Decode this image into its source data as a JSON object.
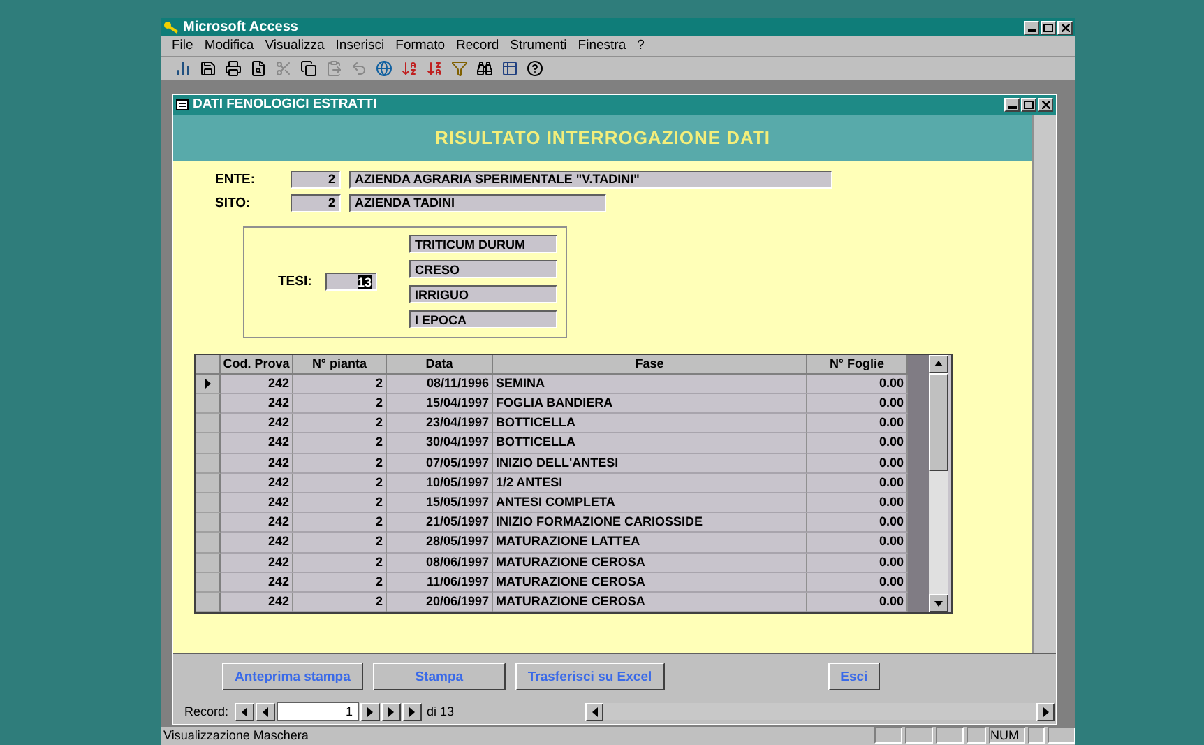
{
  "window": {
    "title": "Microsoft Access"
  },
  "menu": [
    "File",
    "Modifica",
    "Visualizza",
    "Inserisci",
    "Formato",
    "Record",
    "Strumenti",
    "Finestra",
    "?"
  ],
  "form": {
    "title": "DATI FENOLOGICI ESTRATTI",
    "heading": "RISULTATO INTERROGAZIONE DATI",
    "ente": {
      "label": "ENTE:",
      "code": "2",
      "name": "AZIENDA AGRARIA SPERIMENTALE \"V.TADINI\""
    },
    "sito": {
      "label": "SITO:",
      "code": "2",
      "name": "AZIENDA TADINI"
    },
    "tesi": {
      "label": "TESI:",
      "code": "13",
      "details": [
        "TRITICUM DURUM",
        "CRESO",
        "IRRIGUO",
        "I EPOCA"
      ]
    },
    "table": {
      "columns": [
        "Cod. Prova",
        "N° pianta",
        "Data",
        "Fase",
        "N° Foglie"
      ],
      "rows": [
        {
          "selected": true,
          "cells": [
            "242",
            "2",
            "08/11/1996",
            "SEMINA",
            "0.00"
          ]
        },
        {
          "selected": false,
          "cells": [
            "242",
            "2",
            "15/04/1997",
            "FOGLIA BANDIERA",
            "0.00"
          ]
        },
        {
          "selected": false,
          "cells": [
            "242",
            "2",
            "23/04/1997",
            "BOTTICELLA",
            "0.00"
          ]
        },
        {
          "selected": false,
          "cells": [
            "242",
            "2",
            "30/04/1997",
            "BOTTICELLA",
            "0.00"
          ]
        },
        {
          "selected": false,
          "cells": [
            "242",
            "2",
            "07/05/1997",
            "INIZIO DELL'ANTESI",
            "0.00"
          ]
        },
        {
          "selected": false,
          "cells": [
            "242",
            "2",
            "10/05/1997",
            "1/2 ANTESI",
            "0.00"
          ]
        },
        {
          "selected": false,
          "cells": [
            "242",
            "2",
            "15/05/1997",
            "ANTESI COMPLETA",
            "0.00"
          ]
        },
        {
          "selected": false,
          "cells": [
            "242",
            "2",
            "21/05/1997",
            "INIZIO FORMAZIONE CARIOSSIDE",
            "0.00"
          ]
        },
        {
          "selected": false,
          "cells": [
            "242",
            "2",
            "28/05/1997",
            "MATURAZIONE LATTEA",
            "0.00"
          ]
        },
        {
          "selected": false,
          "cells": [
            "242",
            "2",
            "08/06/1997",
            "MATURAZIONE CEROSA",
            "0.00"
          ]
        },
        {
          "selected": false,
          "cells": [
            "242",
            "2",
            "11/06/1997",
            "MATURAZIONE CEROSA",
            "0.00"
          ]
        },
        {
          "selected": false,
          "cells": [
            "242",
            "2",
            "20/06/1997",
            "MATURAZIONE CEROSA",
            "0.00"
          ]
        }
      ]
    },
    "buttons": [
      "Anteprima stampa",
      "Stampa",
      "Trasferisci su Excel",
      "Esci"
    ],
    "navigator": {
      "label": "Record:",
      "current": "1",
      "total": "di 13"
    }
  },
  "status_bar": {
    "text": "Visualizzazione Maschera",
    "indicator": "NUM"
  }
}
